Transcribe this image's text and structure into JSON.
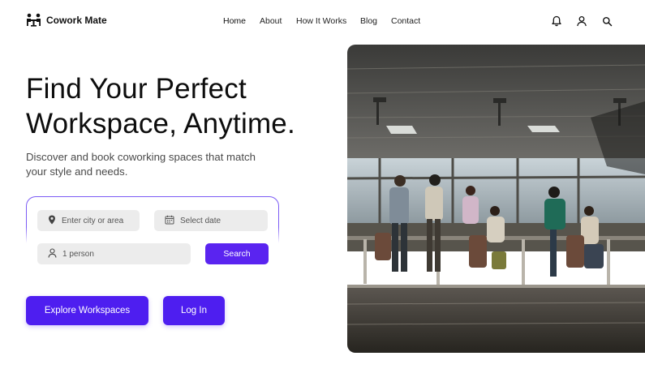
{
  "brand": {
    "name": "Cowork Mate",
    "logo_icon": "people-at-table-icon"
  },
  "nav": {
    "items": [
      {
        "label": "Home",
        "active": true
      },
      {
        "label": "About",
        "active": false
      },
      {
        "label": "How It Works",
        "active": false
      },
      {
        "label": "Blog",
        "active": false
      },
      {
        "label": "Contact",
        "active": false
      }
    ]
  },
  "header_icons": [
    "bell-icon",
    "user-icon",
    "search-icon"
  ],
  "hero": {
    "headline_line1": "Find Your Perfect",
    "headline_line2": "Workspace, Anytime.",
    "subtext": "Discover and book coworking spaces that match your style and needs."
  },
  "search": {
    "location_placeholder": "Enter city or area",
    "date_placeholder": "Select date",
    "guests_value": "1 person",
    "button_label": "Search"
  },
  "cta": {
    "primary_label": "Explore Workspaces",
    "secondary_label": "Log In"
  },
  "colors": {
    "accent": "#5a24f0",
    "accent_dark": "#4e1ef0",
    "card_border": "#7c5cf5",
    "field_bg": "#ececec"
  },
  "image": {
    "subject": "people working in a coworking space"
  }
}
